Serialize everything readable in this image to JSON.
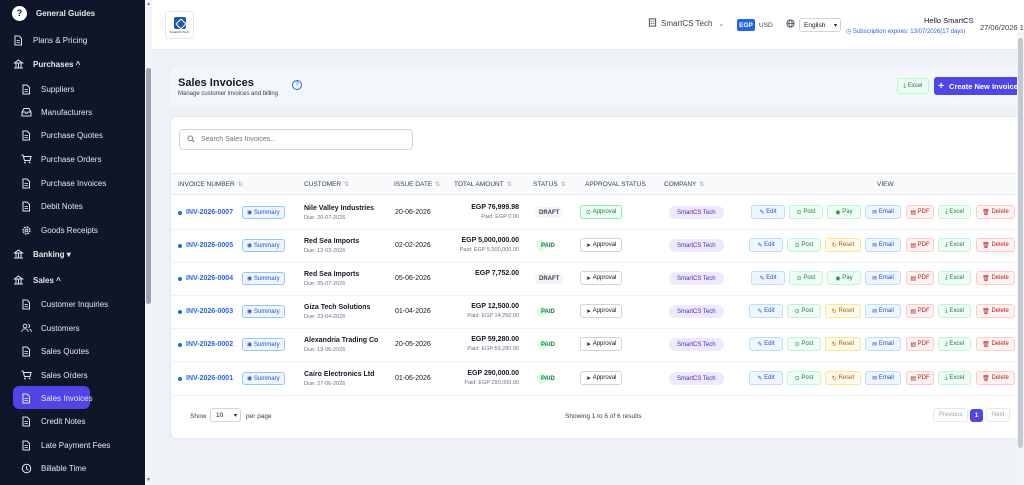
{
  "sidebar": {
    "items": [
      {
        "label": "General Guides",
        "icon": "help-icon",
        "type": "group"
      },
      {
        "label": "Plans & Pricing",
        "icon": "document-icon"
      },
      {
        "label": "Purchases ^",
        "icon": "building-icon",
        "type": "group"
      },
      {
        "label": "Suppliers",
        "icon": "document-icon"
      },
      {
        "label": "Manufacturers",
        "icon": "inbox-icon"
      },
      {
        "label": "Purchase Quotes",
        "icon": "document-icon"
      },
      {
        "label": "Purchase Orders",
        "icon": "cart-icon"
      },
      {
        "label": "Purchase Invoices",
        "icon": "document-icon"
      },
      {
        "label": "Debit Notes",
        "icon": "document-icon"
      },
      {
        "label": "Goods Receipts",
        "icon": "gear-icon"
      },
      {
        "label": "Banking ▾",
        "icon": "building-icon",
        "type": "group"
      },
      {
        "label": "Sales ^",
        "icon": "building-icon",
        "type": "group"
      },
      {
        "label": "Customer Inquiries",
        "icon": "document-icon"
      },
      {
        "label": "Customers",
        "icon": "users-icon"
      },
      {
        "label": "Sales Quotes",
        "icon": "document-icon"
      },
      {
        "label": "Sales Orders",
        "icon": "cart-icon"
      },
      {
        "label": "Sales Invoices",
        "icon": "document-icon",
        "active": true
      },
      {
        "label": "Credit Notes",
        "icon": "document-icon"
      },
      {
        "label": "Late Payment Fees",
        "icon": "document-icon"
      },
      {
        "label": "Billable Time",
        "icon": "clock-icon"
      }
    ]
  },
  "header": {
    "logo_text": "SmartCS Tech",
    "company": "SmartCS Tech",
    "currency_active": "EGP",
    "currency_other": "USD",
    "language": "English",
    "hello": "Hello SmartCS",
    "subscription": "Subscription expires: 13/07/2026(17 days)",
    "date": "27/06/2026 1"
  },
  "page": {
    "title": "Sales Invoices",
    "subtitle": "Manage customer invoices and billing",
    "excel_label": "Excel",
    "create_label": "Create New Invoice"
  },
  "table": {
    "search_placeholder": "Search Sales Invoices...",
    "columns": {
      "invoice_number": "INVOICE NUMBER",
      "customer": "CUSTOMER",
      "issue_date": "ISSUE DATE",
      "total_amount": "TOTAL AMOUNT",
      "status": "STATUS",
      "approval_status": "APPROVAL STATUS",
      "company": "COMPANY",
      "view": "VIEW"
    },
    "labels": {
      "summary": "Summary",
      "edit": "Edit",
      "post": "Post",
      "pay": "Pay",
      "reset": "Reset",
      "email": "Email",
      "pdf": "PDF",
      "excel": "Excel",
      "delete": "Delete"
    },
    "rows": [
      {
        "number": "INV-2026-0007",
        "customer": "Nile Valley Industries",
        "due": "Due: 20-07-2026",
        "issue": "20-06-2026",
        "amount": "EGP 76,999.98",
        "paid": "Paid: EGP 0.00",
        "status": "DRAFT",
        "approval": "Approval",
        "approved": true,
        "company": "SmartCS Tech",
        "middle": "pay"
      },
      {
        "number": "INV-2026-0005",
        "customer": "Red Sea Imports",
        "due": "Due: 12-03-2026",
        "issue": "02-02-2026",
        "amount": "EGP 5,000,000.00",
        "paid": "Paid: EGP 5,000,000.00",
        "status": "PAID",
        "approval": "Approval",
        "approved": false,
        "company": "SmartCS Tech",
        "middle": "reset"
      },
      {
        "number": "INV-2026-0004",
        "customer": "Red Sea Imports",
        "due": "Due: 05-07-2026",
        "issue": "05-06-2026",
        "amount": "EGP 7,752.00",
        "paid": "",
        "status": "DRAFT",
        "approval": "Approval",
        "approved": false,
        "company": "SmartCS Tech",
        "middle": "pay"
      },
      {
        "number": "INV-2026-0003",
        "customer": "Giza Tech Solutions",
        "due": "Due: 23-04-2026",
        "issue": "01-04-2026",
        "amount": "EGP 12,500.00",
        "paid": "Paid: EGP 14,250.00",
        "status": "PAID",
        "approval": "Approval",
        "approved": false,
        "company": "SmartCS Tech",
        "middle": "reset"
      },
      {
        "number": "INV-2026-0002",
        "customer": "Alexandria Trading Co",
        "due": "Due: 19-06-2026",
        "issue": "20-05-2026",
        "amount": "EGP 59,280.00",
        "paid": "Paid: EGP 59,280.00",
        "status": "PAID",
        "approval": "Approval",
        "approved": false,
        "company": "SmartCS Tech",
        "middle": "reset"
      },
      {
        "number": "INV-2026-0001",
        "customer": "Cairo Electronics Ltd",
        "due": "Due: 27-06-2026",
        "issue": "01-06-2026",
        "amount": "EGP 290,000.00",
        "paid": "Paid: EGP 290,000.00",
        "status": "PAID",
        "approval": "Approval",
        "approved": false,
        "company": "SmartCS Tech",
        "middle": "reset"
      }
    ]
  },
  "footer": {
    "show": "Show",
    "page_size": "10",
    "per_page": "per page",
    "showing": "Showing 1 to 6 of 6 results",
    "previous": "Previous",
    "current_page": "1",
    "next": "Next"
  },
  "colors": {
    "sidebar_bg": "#0f1629",
    "accent": "#4f46e5",
    "link": "#2563eb"
  }
}
